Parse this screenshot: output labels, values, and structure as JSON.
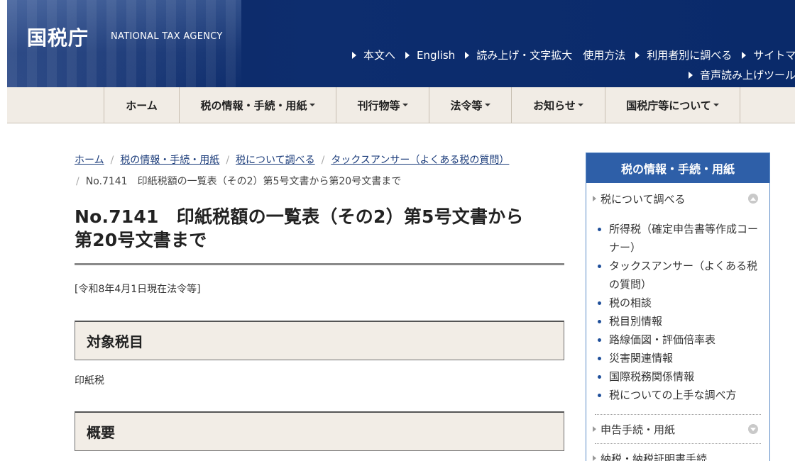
{
  "header": {
    "logo_ja": "国税庁",
    "logo_en": "NATIONAL TAX AGENCY",
    "util_links": [
      "本文へ",
      "English",
      "読み上げ・文字拡大　使用方法",
      "利用者別に調べる",
      "サイトマ"
    ],
    "util_links_row2": [
      "音声読み上げツール"
    ]
  },
  "nav": {
    "items": [
      {
        "label": "ホーム",
        "dropdown": false
      },
      {
        "label": "税の情報・手続・用紙",
        "dropdown": true
      },
      {
        "label": "刊行物等",
        "dropdown": true
      },
      {
        "label": "法令等",
        "dropdown": true
      },
      {
        "label": "お知らせ",
        "dropdown": true
      },
      {
        "label": "国税庁等について",
        "dropdown": true
      }
    ]
  },
  "breadcrumb": {
    "links": [
      "ホーム",
      "税の情報・手続・用紙",
      "税について調べる",
      "タックスアンサー（よくある税の質問）"
    ],
    "current": "No.7141　印紙税額の一覧表（その2）第5号文書から第20号文書まで"
  },
  "main": {
    "title_line1": "No.7141　印紙税額の一覧表（その2）第5号文書から",
    "title_line2": "第20号文書まで",
    "date_note": "[令和8年4月1日現在法令等]",
    "section1_heading": "対象税目",
    "section1_body": "印紙税",
    "section2_heading": "概要"
  },
  "sidebar": {
    "heading": "税の情報・手続・用紙",
    "category1": "税について調べる",
    "items": [
      "所得税（確定申告書等作成コーナー）",
      "タックスアンサー（よくある税の質問）",
      "税の相談",
      "税目別情報",
      "路線価図・評価倍率表",
      "災害関連情報",
      "国際税務関係情報",
      "税についての上手な調べ方"
    ],
    "category2": "申告手続・用紙",
    "category3": "納税・納税証明書手続"
  },
  "colors": {
    "header_bg": "#0d2d6e",
    "nav_bg": "#f1ece5",
    "sidebar_head": "#2e5fa8",
    "link": "#1a3b7a"
  }
}
